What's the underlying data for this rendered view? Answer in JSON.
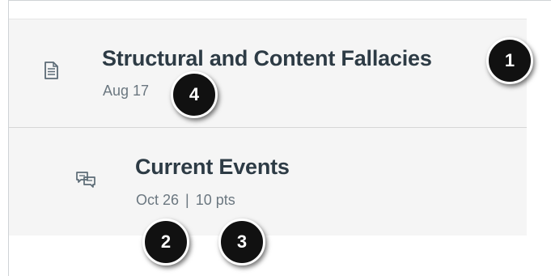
{
  "items": [
    {
      "icon": "document-icon",
      "title": "Structural and Content Fallacies",
      "date": "Aug 17"
    },
    {
      "icon": "discussion-icon",
      "title": "Current Events",
      "date": "Oct 26",
      "separator": "|",
      "points": "10 pts"
    }
  ],
  "callouts": {
    "c1": "1",
    "c2": "2",
    "c3": "3",
    "c4": "4"
  },
  "colors": {
    "row_background": "#f5f5f5",
    "title_text": "#2d3b45",
    "meta_text": "#6b7780",
    "callout_fill": "#111111"
  }
}
